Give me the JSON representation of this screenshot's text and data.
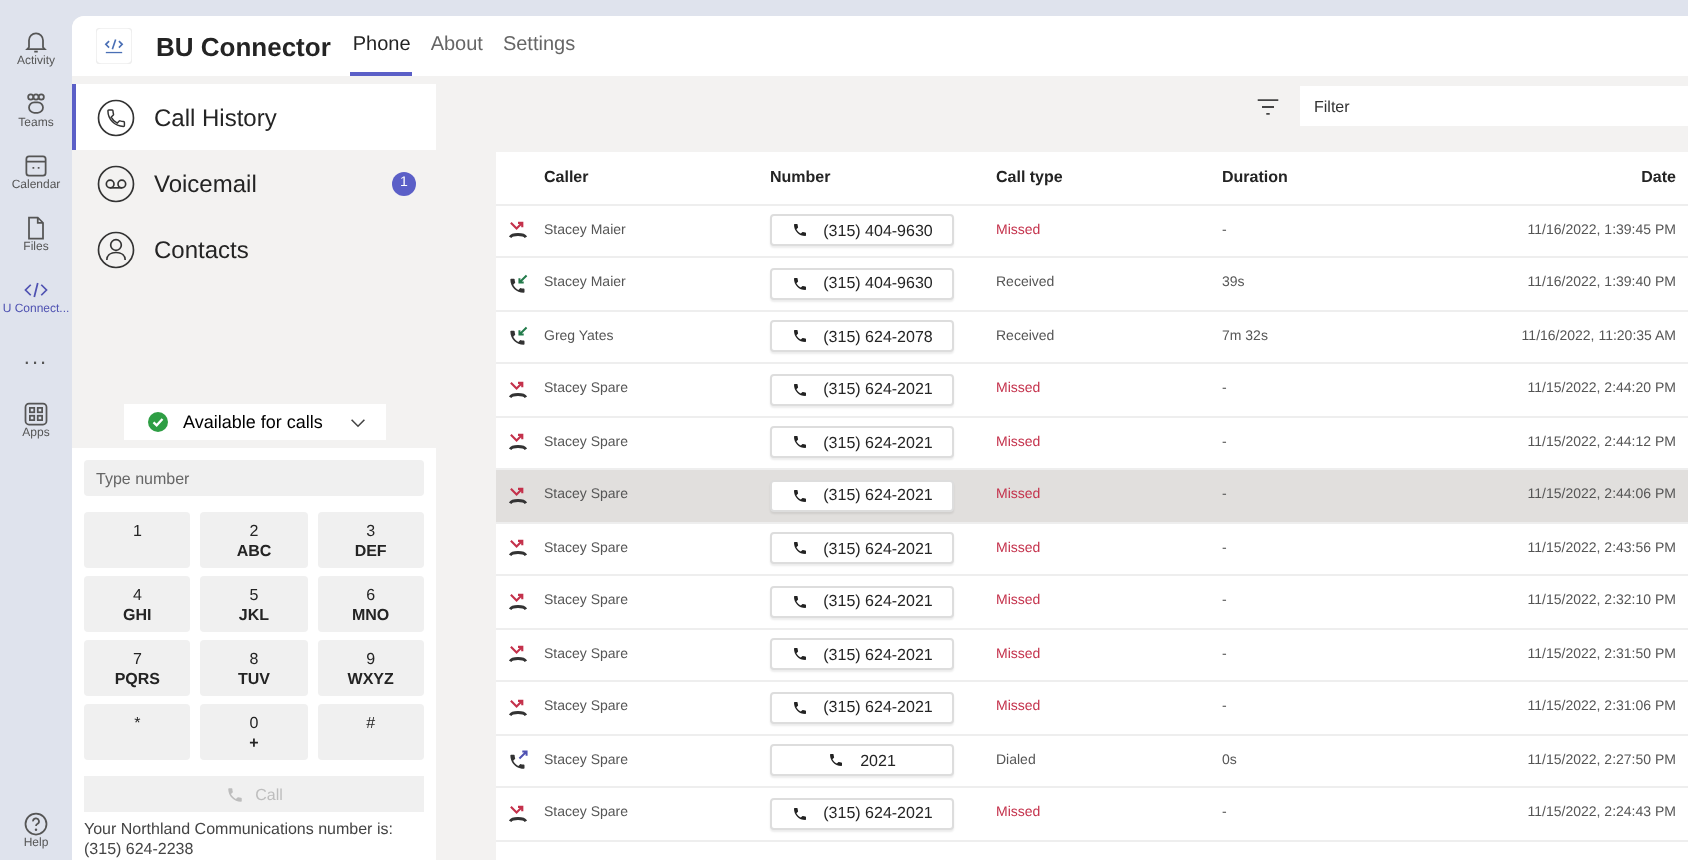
{
  "rail": [
    {
      "label": "Activity",
      "selected": false
    },
    {
      "label": "Teams",
      "selected": false
    },
    {
      "label": "Calendar",
      "selected": false
    },
    {
      "label": "Files",
      "selected": false
    },
    {
      "label": "U Connect...",
      "selected": true
    },
    {
      "label": "...",
      "selected": false
    },
    {
      "label": "Apps",
      "selected": false
    }
  ],
  "rail_bottom": {
    "label": "Help"
  },
  "app": {
    "title": "BU Connector",
    "tabs": [
      {
        "label": "Phone",
        "selected": true
      },
      {
        "label": "About",
        "selected": false
      },
      {
        "label": "Settings",
        "selected": false
      }
    ]
  },
  "nav": [
    {
      "label": "Call History",
      "selected": true
    },
    {
      "label": "Voicemail",
      "selected": false,
      "badge": "1"
    },
    {
      "label": "Contacts",
      "selected": false
    }
  ],
  "status": {
    "label": "Available for calls",
    "available": true
  },
  "dialer": {
    "placeholder": "Type number",
    "keys": [
      {
        "digit": "1"
      },
      {
        "digit": "2",
        "letters": "ABC"
      },
      {
        "digit": "3",
        "letters": "DEF"
      },
      {
        "digit": "4",
        "letters": "GHI"
      },
      {
        "digit": "5",
        "letters": "JKL"
      },
      {
        "digit": "6",
        "letters": "MNO"
      },
      {
        "digit": "7",
        "letters": "PQRS"
      },
      {
        "digit": "8",
        "letters": "TUV"
      },
      {
        "digit": "9",
        "letters": "WXYZ"
      },
      {
        "digit": "*"
      },
      {
        "digit": "0",
        "letters": "+"
      },
      {
        "digit": "#"
      }
    ],
    "call_button": {
      "label": "Call",
      "disabled": true
    },
    "footer": "Your Northland Communications number is:",
    "own_number": "(315) 624-2238"
  },
  "filter": {
    "placeholder": "Filter"
  },
  "table": {
    "columns": [
      "Caller",
      "Number",
      "Call type",
      "Duration",
      "Date"
    ],
    "rows": [
      {
        "kind": "missed",
        "caller": "Stacey Maier",
        "number": "(315) 404-9630",
        "type": "Missed",
        "duration": "-",
        "date": "11/16/2022, 1:39:45 PM",
        "selected": false
      },
      {
        "kind": "received",
        "caller": "Stacey Maier",
        "number": "(315) 404-9630",
        "type": "Received",
        "duration": "39s",
        "date": "11/16/2022, 1:39:40 PM",
        "selected": false
      },
      {
        "kind": "received",
        "caller": "Greg Yates",
        "number": "(315) 624-2078",
        "type": "Received",
        "duration": "7m 32s",
        "date": "11/16/2022, 11:20:35 AM",
        "selected": false
      },
      {
        "kind": "missed",
        "caller": "Stacey Spare",
        "number": "(315) 624-2021",
        "type": "Missed",
        "duration": "-",
        "date": "11/15/2022, 2:44:20 PM",
        "selected": false
      },
      {
        "kind": "missed",
        "caller": "Stacey Spare",
        "number": "(315) 624-2021",
        "type": "Missed",
        "duration": "-",
        "date": "11/15/2022, 2:44:12 PM",
        "selected": false
      },
      {
        "kind": "missed",
        "caller": "Stacey Spare",
        "number": "(315) 624-2021",
        "type": "Missed",
        "duration": "-",
        "date": "11/15/2022, 2:44:06 PM",
        "selected": true
      },
      {
        "kind": "missed",
        "caller": "Stacey Spare",
        "number": "(315) 624-2021",
        "type": "Missed",
        "duration": "-",
        "date": "11/15/2022, 2:43:56 PM",
        "selected": false
      },
      {
        "kind": "missed",
        "caller": "Stacey Spare",
        "number": "(315) 624-2021",
        "type": "Missed",
        "duration": "-",
        "date": "11/15/2022, 2:32:10 PM",
        "selected": false
      },
      {
        "kind": "missed",
        "caller": "Stacey Spare",
        "number": "(315) 624-2021",
        "type": "Missed",
        "duration": "-",
        "date": "11/15/2022, 2:31:50 PM",
        "selected": false
      },
      {
        "kind": "missed",
        "caller": "Stacey Spare",
        "number": "(315) 624-2021",
        "type": "Missed",
        "duration": "-",
        "date": "11/15/2022, 2:31:06 PM",
        "selected": false
      },
      {
        "kind": "dialed",
        "caller": "Stacey Spare",
        "number": "2021",
        "type": "Dialed",
        "duration": "0s",
        "date": "11/15/2022, 2:27:50 PM",
        "selected": false
      },
      {
        "kind": "missed",
        "caller": "Stacey Spare",
        "number": "(315) 624-2021",
        "type": "Missed",
        "duration": "-",
        "date": "11/15/2022, 2:24:43 PM",
        "selected": false
      }
    ]
  }
}
